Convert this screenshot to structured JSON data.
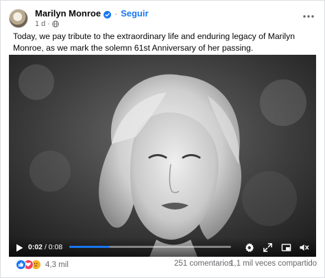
{
  "post": {
    "author": "Marilyn Monroe",
    "follow_label": "Seguir",
    "timestamp": "1 d",
    "text": "Today, we pay tribute to the extraordinary life and enduring legacy of Marilyn Monroe, as we mark the solemn 61st Anniversary of her passing."
  },
  "video": {
    "current_time": "0:02",
    "total_time": "0:08",
    "separator": "/",
    "progress": 0.25
  },
  "footer": {
    "reaction_count": "4,3 mil",
    "comments": "251 comentarios",
    "shares": "1,1 mil veces compartido"
  },
  "icons": {
    "verified": "verified-badge-icon",
    "globe": "globe-icon",
    "more": "more-options-icon",
    "reactions": [
      "like-icon",
      "love-icon",
      "sad-icon"
    ],
    "controls": [
      "play-icon",
      "settings-icon",
      "fullscreen-icon",
      "pip-icon",
      "mute-icon"
    ]
  },
  "colors": {
    "accent": "#1877f2",
    "meta_text": "#65676b",
    "like": "#1877f2",
    "love": "#f33e58",
    "sad": "#f7b125"
  }
}
